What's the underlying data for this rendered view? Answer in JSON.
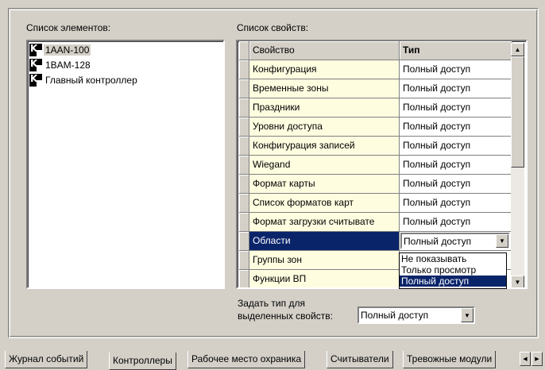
{
  "elements_label": "Список элементов:",
  "properties_label": "Список свойств:",
  "elements": [
    {
      "name": "1AAN-100"
    },
    {
      "name": "1BAM-128"
    },
    {
      "name": "Главный контроллер"
    }
  ],
  "grid": {
    "header": {
      "property": "Свойство",
      "type": "Тип"
    },
    "rows": [
      {
        "property": "Конфигурация",
        "type": "Полный доступ"
      },
      {
        "property": "Временные зоны",
        "type": "Полный доступ"
      },
      {
        "property": "Праздники",
        "type": "Полный доступ"
      },
      {
        "property": "Уровни доступа",
        "type": "Полный доступ"
      },
      {
        "property": "Конфигурация записей",
        "type": "Полный доступ"
      },
      {
        "property": "Wiegand",
        "type": "Полный доступ"
      },
      {
        "property": "Формат карты",
        "type": "Полный доступ"
      },
      {
        "property": "Список форматов карт",
        "type": "Полный доступ"
      },
      {
        "property": "Формат загрузки считывате",
        "type": "Полный доступ"
      },
      {
        "property": "Области",
        "type": "Полный доступ"
      },
      {
        "property": "Группы зон",
        "type": ""
      },
      {
        "property": "Функции ВП",
        "type": ""
      }
    ]
  },
  "dropdown_options": [
    "Не показывать",
    "Только просмотр",
    "Полный доступ"
  ],
  "set_type_label_1": "Задать тип для",
  "set_type_label_2": "выделенных свойств:",
  "set_type_value": "Полный доступ",
  "tabs": [
    "Журнал событий",
    "Контроллеры",
    "Рабочее место охраника",
    "Считыватели",
    "Тревожные модули"
  ],
  "colors": {
    "selection": "#0a246a",
    "property_cell": "#fffde0",
    "face": "#d4d0c8"
  }
}
